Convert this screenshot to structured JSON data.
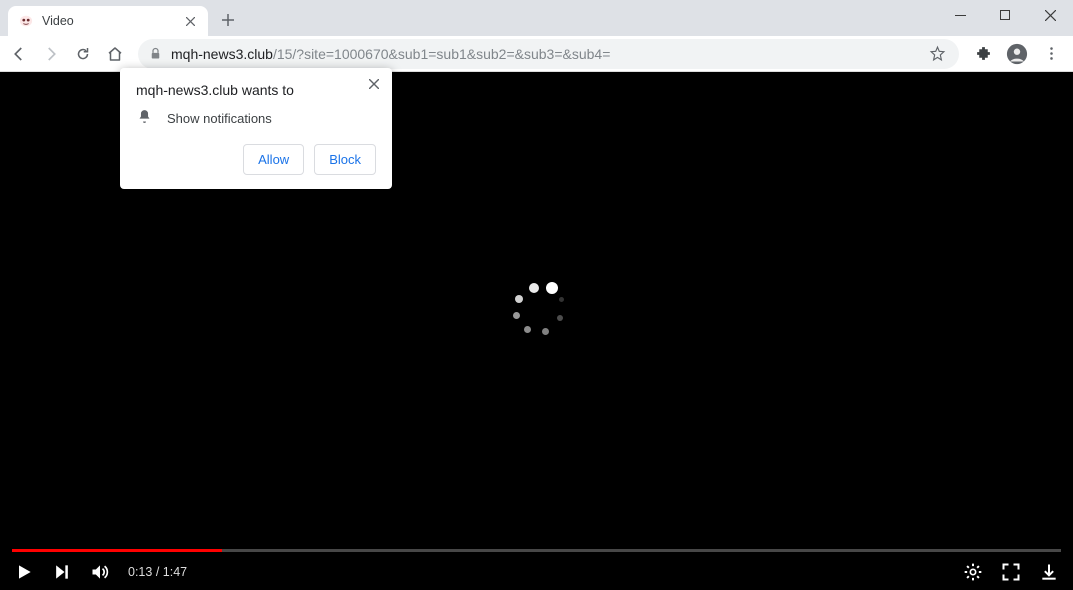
{
  "tab": {
    "title": "Video"
  },
  "toolbar": {
    "url_domain": "mqh-news3.club",
    "url_rest": "/15/?site=1000670&sub1=sub1&sub2=&sub3=&sub4="
  },
  "permission": {
    "title": "mqh-news3.club wants to",
    "item": "Show notifications",
    "allow": "Allow",
    "block": "Block"
  },
  "video": {
    "current_time": "0:13",
    "duration": "1:47",
    "progress_percent": 20
  }
}
